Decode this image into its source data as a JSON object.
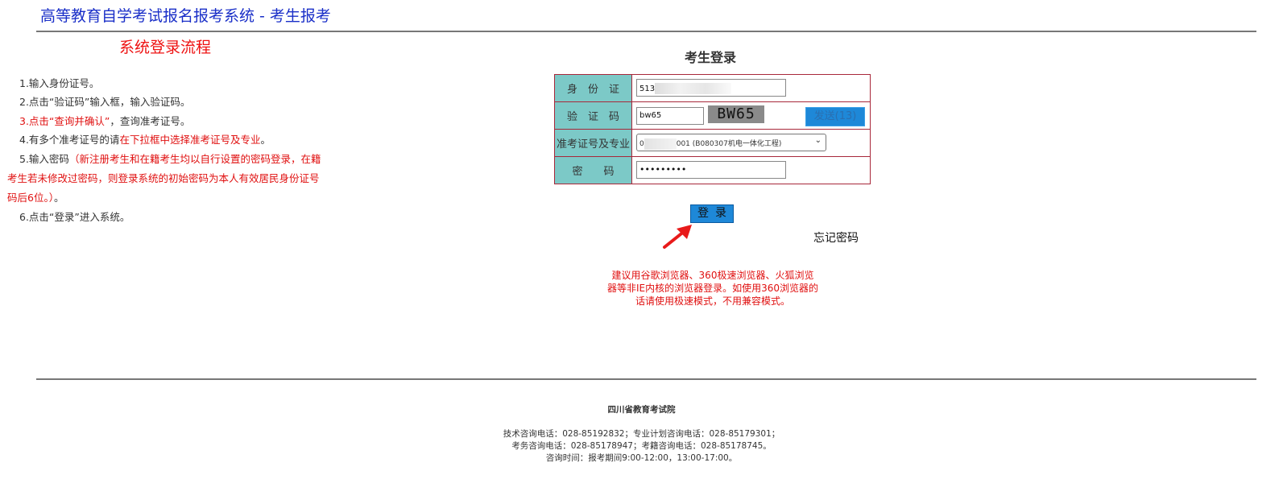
{
  "header": {
    "title": "高等教育自学考试报名报考系统 - 考生报考"
  },
  "steps": {
    "title": "系统登录流程",
    "s1": "1.输入身份证号。",
    "s2": "2.点击“验证码”输入框，输入验证码。",
    "s3_red": "3.点击“查询并确认”",
    "s3_rest": "，查询准考证号。",
    "s4_a": "4.有多个准考证号的请",
    "s4_red": "在下拉框中选择准考证号及专业",
    "s4_b": "。",
    "s5_a": "5.输入密码",
    "s5_red_1": "（新注册考生和在籍考生均以自行设置的密码登录，在籍",
    "s5_red_2": "考生若未修改过密码，则登录系统的初始密码为本人有效居民身份证号",
    "s5_red_3": "码后6位。）",
    "s5_b": "。",
    "s6": "6.点击“登录”进入系统。"
  },
  "login": {
    "title": "考生登录",
    "id_label": "身　份　证",
    "id_value_prefix": "513",
    "captcha_label": "验　证　码",
    "captcha_value": "bw65",
    "captcha_image_text": "BW65",
    "send_button": "发送(13)",
    "exam_label": "准考证号及专业",
    "exam_select_prefix": "0",
    "exam_select_suffix": "001 (B080307机电一体化工程)",
    "password_label": "密　　码",
    "password_value": "•••••••••",
    "login_button": "登录",
    "forgot": "忘记密码"
  },
  "tip": {
    "line1": "建议用谷歌浏览器、360极速浏览器、火狐浏览",
    "line2": "器等非IE内核的浏览器登录。如使用360浏览器的",
    "line3": "话请使用极速模式，不用兼容模式。"
  },
  "footer": {
    "org": "四川省教育考试院",
    "line1": "技术咨询电话：028-85192832；专业计划咨询电话：028-85179301；",
    "line2": "考务咨询电话：028-85178947；考籍咨询电话：028-85178745。",
    "line3": "咨询时间：报考期间9:00-12:00，13:00-17:00。"
  },
  "colors": {
    "accent": "#1e88d8",
    "label_bg": "#7cc9c7",
    "border": "#a8283a",
    "warning": "#e01010",
    "title": "#1a2fc8"
  },
  "icons": {
    "arrow": "red-arrow-icon",
    "select_chevron": "chevron-down-icon"
  }
}
